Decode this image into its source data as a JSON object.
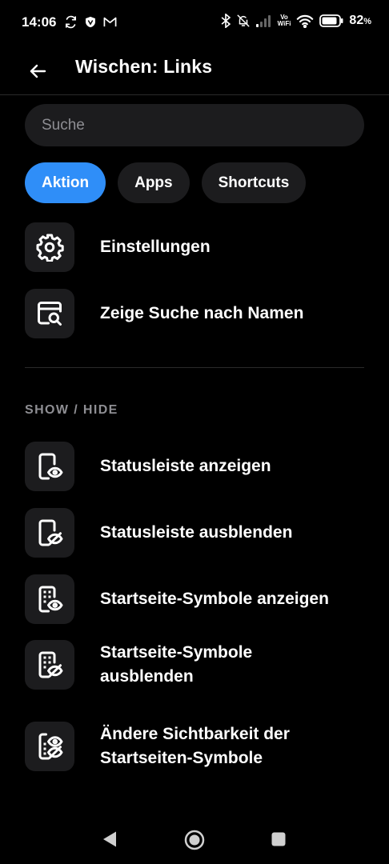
{
  "status_bar": {
    "time": "14:06",
    "battery": "82",
    "battery_unit": "%",
    "vowifi_top": "Vo",
    "vowifi_bottom": "WiFi"
  },
  "header": {
    "title": "Wischen: Links"
  },
  "search": {
    "placeholder": "Suche"
  },
  "tabs": [
    {
      "label": "Aktion",
      "active": true
    },
    {
      "label": "Apps",
      "active": false
    },
    {
      "label": "Shortcuts",
      "active": false
    }
  ],
  "actions": [
    {
      "label": "Einstellungen",
      "icon": "gear-icon"
    },
    {
      "label": "Zeige Suche nach Namen",
      "icon": "window-search-icon"
    }
  ],
  "show_hide": {
    "header": "SHOW / HIDE",
    "items": [
      {
        "label": "Statusleiste anzeigen",
        "icon": "phone-eye-icon"
      },
      {
        "label": "Statusleiste ausblenden",
        "icon": "phone-eye-off-icon"
      },
      {
        "label": "Startseite-Symbole anzeigen",
        "icon": "phone-grid-eye-icon"
      },
      {
        "label": "Startseite-Symbole ausblenden",
        "icon": "phone-grid-eye-off-icon"
      },
      {
        "label": "Ändere Sichtbarkeit der Startseiten-Symbole",
        "icon": "phone-grid-toggle-visibility-icon"
      }
    ]
  },
  "colors": {
    "accent": "#2f8ef8",
    "surface": "#1c1c1e",
    "background": "#000000",
    "muted_text": "#8e8e93"
  }
}
